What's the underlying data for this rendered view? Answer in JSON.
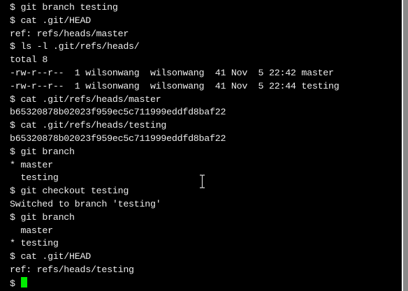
{
  "terminal": {
    "lines": [
      "$ git branch testing",
      "$ cat .git/HEAD",
      "ref: refs/heads/master",
      "$ ls -l .git/refs/heads/",
      "total 8",
      "-rw-r--r--  1 wilsonwang  wilsonwang  41 Nov  5 22:42 master",
      "-rw-r--r--  1 wilsonwang  wilsonwang  41 Nov  5 22:44 testing",
      "$ cat .git/refs/heads/master",
      "b65320878b02023f959ec5c711999eddfd8baf22",
      "$ cat .git/refs/heads/testing",
      "b65320878b02023f959ec5c711999eddfd8baf22",
      "$ git branch",
      "* master",
      "  testing",
      "$ git checkout testing",
      "Switched to branch 'testing'",
      "$ git branch",
      "  master",
      "* testing",
      "$ cat .git/HEAD",
      "ref: refs/heads/testing"
    ],
    "prompt": "$",
    "cursor_color": "#00ee00"
  }
}
